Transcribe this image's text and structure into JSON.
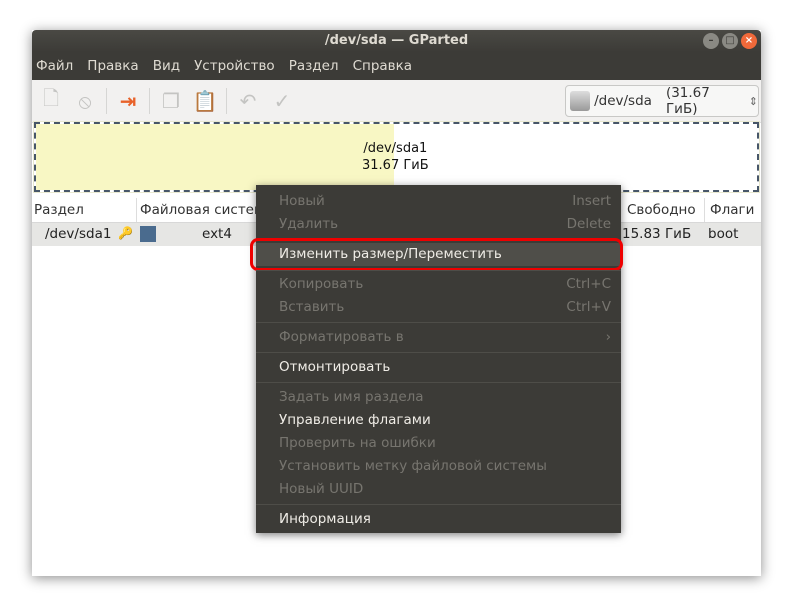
{
  "window": {
    "title": "/dev/sda — GParted"
  },
  "menubar": [
    "Файл",
    "Правка",
    "Вид",
    "Устройство",
    "Раздел",
    "Справка"
  ],
  "device_selector": {
    "device": "/dev/sda",
    "size": "(31.67 ГиБ)"
  },
  "graph": {
    "name": "/dev/sda1",
    "size": "31.67 ГиБ",
    "used_fraction": 0.5
  },
  "table": {
    "headers": [
      "Раздел",
      "Файловая систем",
      "Свободно",
      "Флаги"
    ],
    "row": {
      "partition": "/dev/sda1",
      "fs": "ext4",
      "free": "15.83 ГиБ",
      "flags": "boot",
      "fs_color": "#4a6b8e"
    }
  },
  "context_menu": {
    "items": [
      {
        "label": "Новый",
        "shortcut": "Insert",
        "enabled": false
      },
      {
        "label": "Удалить",
        "shortcut": "Delete",
        "enabled": false
      },
      {
        "label": "Изменить размер/Переместить",
        "enabled": true,
        "highlighted": true
      },
      {
        "label": "Копировать",
        "shortcut": "Ctrl+C",
        "enabled": false
      },
      {
        "label": "Вставить",
        "shortcut": "Ctrl+V",
        "enabled": false
      },
      {
        "label": "Форматировать в",
        "shortcut": "›",
        "enabled": false
      },
      {
        "label": "Отмонтировать",
        "enabled": true
      },
      {
        "label": "Задать имя раздела",
        "enabled": false
      },
      {
        "label": "Управление флагами",
        "enabled": true
      },
      {
        "label": "Проверить на ошибки",
        "enabled": false
      },
      {
        "label": "Установить метку файловой системы",
        "enabled": false
      },
      {
        "label": "Новый UUID",
        "enabled": false
      },
      {
        "label": "Информация",
        "enabled": true
      }
    ]
  }
}
